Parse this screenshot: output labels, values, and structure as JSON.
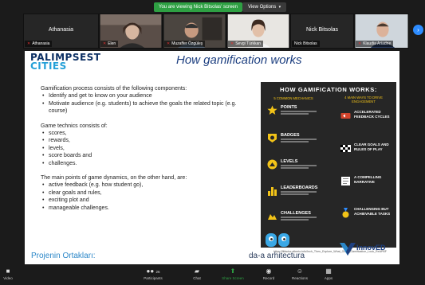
{
  "banner": {
    "viewing_text": "You are viewing Nick Bitsolas' screen",
    "view_options": "View Options"
  },
  "participants": [
    {
      "big_name": "Athanasia",
      "tag": "Athanasia",
      "has_video": false
    },
    {
      "big_name": "",
      "tag": "Elen",
      "has_video": true
    },
    {
      "big_name": "",
      "tag": "Muzaffer Özgüleş",
      "has_video": true
    },
    {
      "big_name": "",
      "tag": "Sevgi Türkkan",
      "has_video": true
    },
    {
      "big_name": "Nick Bitsolas",
      "tag": "Nick Bitsolas",
      "has_video": false
    },
    {
      "big_name": "",
      "tag": "Klaudia Ariadne",
      "has_video": true
    }
  ],
  "slide": {
    "logo_line1": "PALIMPSEST",
    "logo_line2": "CITIES",
    "title": "How gamification works",
    "intro": "Gamification process consists of the following components:",
    "components": [
      "Identify and get to know on your audience",
      "Motivate audience (e.g. students) to achieve the goals the related topic (e.g. course)"
    ],
    "technics_intro": "Game technics consists of:",
    "technics": [
      "scores,",
      "rewards,",
      "levels,",
      "score boards and",
      "challenges."
    ],
    "dynamics_intro": "The main points of game dynamics, on the other hand, are:",
    "dynamics": [
      "active feedback (e.g. how student go),",
      "clear goals and rules,",
      "exciting plot and",
      "manageable challenges."
    ],
    "partners_heading": "Projenin Ortakları:",
    "daa_logo_text": "da-a arhitectura",
    "innoved_logo_text": "InnovED"
  },
  "infographic": {
    "title": "HOW GAMIFICATION WORKS:",
    "left_sub": "5 COMMON MECHANICS",
    "right_sub": "4 MAIN WAYS TO DRIVE ENGAGEMENT",
    "mechanics": [
      "POINTS",
      "BADGES",
      "LEVELS",
      "LEADERBOARDS",
      "CHALLENGES"
    ],
    "engagement": [
      "ACCELERATED FEEDBACK CYCLES",
      "CLEAR GOALS AND RULES OF PLAY",
      "A COMPELLING NARRATIVE",
      "CHALLENGING BUT ACHIEVABLE TASKS"
    ],
    "caption": "https://fitfactor.alberto.info/Inch_Then_Explore_What_Goes_Gamification_Look_ReAPBF"
  },
  "toolbar": {
    "items": [
      {
        "label": "Video",
        "icon": "video-icon"
      },
      {
        "label": "Participants",
        "icon": "participants-icon",
        "count": "26"
      },
      {
        "label": "Chat",
        "icon": "chat-icon"
      },
      {
        "label": "Share Screen",
        "icon": "share-screen-icon"
      },
      {
        "label": "Record",
        "icon": "record-icon"
      },
      {
        "label": "Reactions",
        "icon": "reactions-icon"
      },
      {
        "label": "Apps",
        "icon": "apps-icon"
      }
    ]
  },
  "colors": {
    "banner_green": "#2ea043",
    "slide_title_blue": "#1d3f80",
    "infographic_bg": "#262626",
    "infographic_accent": "#f2c318",
    "zoom_blue": "#2d8cff"
  }
}
